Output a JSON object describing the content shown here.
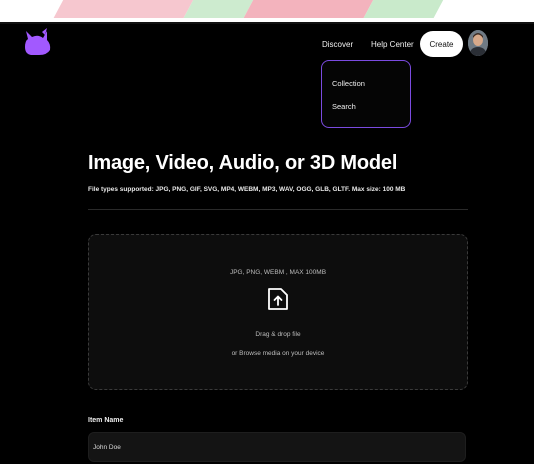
{
  "nav": {
    "discover": "Discover",
    "help_center": "Help Center",
    "create": "Create",
    "dropdown": [
      "Collection",
      "Search"
    ]
  },
  "page": {
    "title": "Image, Video, Audio, or 3D Model",
    "subtitle": "File types supported: JPG, PNG, GIF, SVG, MP4, WEBM, MP3, WAV, OGG, GLB, GLTF. Max size: 100 MB"
  },
  "upload": {
    "formats": "JPG, PNG, WEBM , MAX 100MB",
    "drag": "Drag & drop file",
    "browse": "or Browse media on your device"
  },
  "form": {
    "item_name_label": "Item Name",
    "item_name_value": "John Doe"
  },
  "colors": {
    "accent": "#a259ff",
    "dropdown_border": "#7b4be0",
    "background": "#000000"
  },
  "icons": {
    "logo": "cat-logo-icon",
    "upload": "upload-file-icon"
  }
}
